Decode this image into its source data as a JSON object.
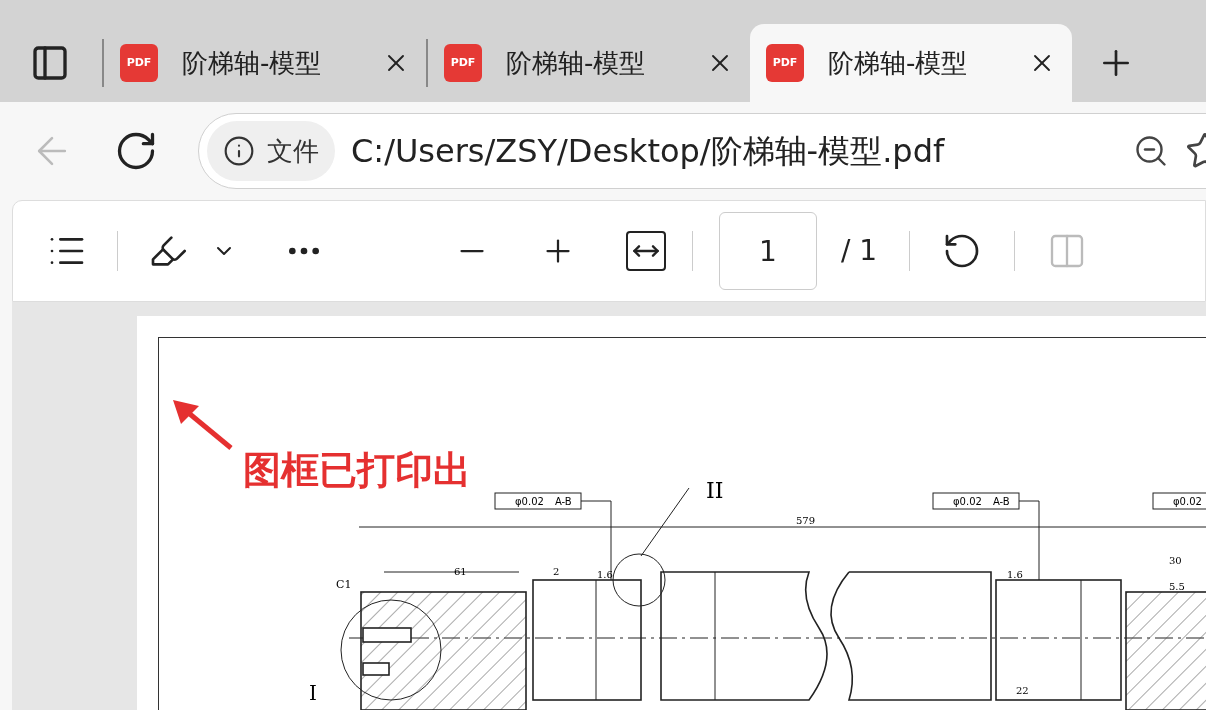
{
  "tabs": [
    {
      "icon_label": "PDF",
      "title": "阶梯轴-模型",
      "selected": false
    },
    {
      "icon_label": "PDF",
      "title": "阶梯轴-模型",
      "selected": false
    },
    {
      "icon_label": "PDF",
      "title": "阶梯轴-模型",
      "selected": true
    }
  ],
  "address": {
    "badge": "文件",
    "url": "C:/Users/ZSY/Desktop/阶梯轴-模型.pdf"
  },
  "pdf_toolbar": {
    "page": "1",
    "total": "/ 1"
  },
  "annotation": "图框已打印出",
  "drawing": {
    "frames": [
      {
        "tolerance": "φ0.02",
        "datum": "A-B"
      },
      {
        "tolerance": "φ0.02",
        "datum": "A-B"
      },
      {
        "tolerance": "φ0.02"
      }
    ],
    "labels": [
      "II",
      "579",
      "C1",
      "61",
      "2",
      "1.6",
      "1.6",
      "22",
      "30",
      "5.5",
      "I"
    ]
  }
}
